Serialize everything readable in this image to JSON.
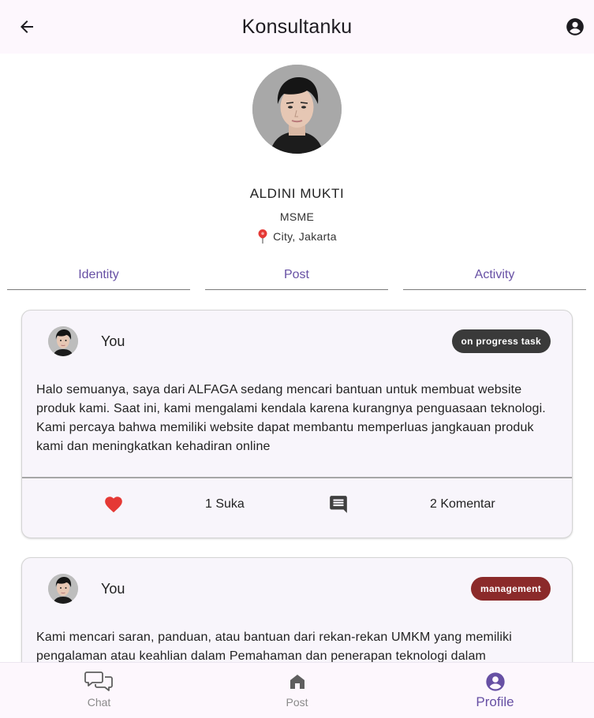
{
  "appbar": {
    "title": "Konsultanku",
    "back_icon": "arrow-left-icon",
    "account_icon": "account-circle-icon"
  },
  "profile": {
    "name": "ALDINI MUKTI",
    "role": "MSME",
    "location": "City, Jakarta",
    "location_icon": "map-pin-icon"
  },
  "tabs": [
    {
      "label": "Identity"
    },
    {
      "label": "Post"
    },
    {
      "label": "Activity"
    }
  ],
  "posts": [
    {
      "author": "You",
      "badge": "on progress task",
      "badge_color": "#3a3a3a",
      "text": "Halo semuanya, saya dari ALFAGA sedang mencari bantuan untuk membuat website produk kami. Saat ini, kami mengalami kendala karena kurangnya penguasaan teknologi. Kami percaya bahwa memiliki website dapat membantu memperluas jangkauan produk kami dan meningkatkan kehadiran online",
      "likes": "1 Suka",
      "comments": "2 Komentar"
    },
    {
      "author": "You",
      "badge": "management",
      "badge_color": "#8b2a2a",
      "text": "Kami mencari saran, panduan, atau bantuan dari rekan-rekan UMKM yang memiliki pengalaman atau keahlian dalam Pemahaman dan penerapan teknologi dalam"
    }
  ],
  "colors": {
    "accent": "#6750a4",
    "like": "#e53935",
    "appbar_bg": "#fdf7fd",
    "card_bg": "#f8f5fb"
  },
  "bottom_nav": [
    {
      "label": "Chat",
      "icon": "chat-bubbles-icon"
    },
    {
      "label": "Post",
      "icon": "home-icon"
    },
    {
      "label": "Profile",
      "icon": "account-circle-icon",
      "active": true
    }
  ]
}
